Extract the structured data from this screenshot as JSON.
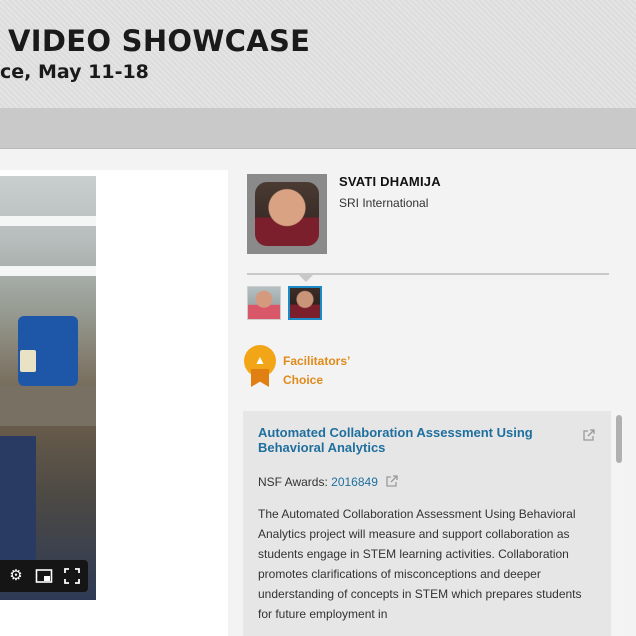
{
  "header": {
    "title": "VIDEO SHOWCASE",
    "subtitle": "ce, May 11-18"
  },
  "video": {
    "controls": {
      "settings": "settings-icon",
      "pip": "picture-in-picture-icon",
      "fullscreen": "fullscreen-icon"
    }
  },
  "presenter": {
    "name": "SVATI DHAMIJA",
    "organization": "SRI International"
  },
  "award": {
    "label_line1": "Facilitators’",
    "label_line2": "Choice"
  },
  "project": {
    "title": "Automated Collaboration Assessment Using Behavioral Analytics",
    "awards_label": "NSF Awards:",
    "award_number": "2016849",
    "description": "The Automated Collaboration Assessment Using Behavioral Analytics project will measure and support collaboration as students engage in STEM learning activities. Collaboration promotes clarifications of misconceptions and deeper understanding of concepts in STEM which prepares students for future employment in"
  },
  "colors": {
    "link": "#1f6f9e",
    "badge_orange": "#f2a516",
    "facilitators_text": "#e08a1a",
    "selected_thumb": "#1c8ac7"
  }
}
